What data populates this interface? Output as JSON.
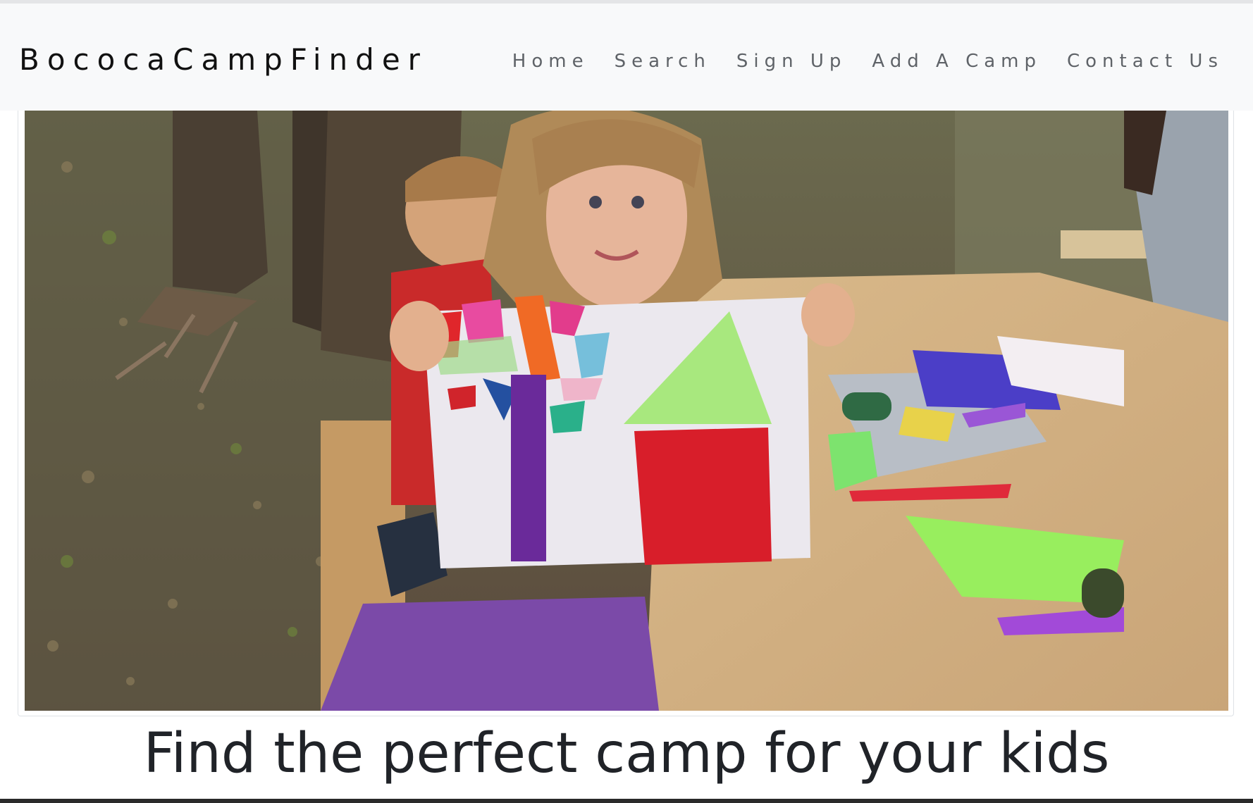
{
  "brand": {
    "name": "BococaCampFinder"
  },
  "nav": {
    "items": [
      {
        "label": "Home"
      },
      {
        "label": "Search"
      },
      {
        "label": "Sign Up"
      },
      {
        "label": "Add A Camp"
      },
      {
        "label": "Contact Us"
      }
    ]
  },
  "hero": {
    "headline": "Find the perfect camp for your kids"
  },
  "colors": {
    "navbar_bg": "#f8f9fa",
    "nav_link": "#5f6368",
    "brand_text": "#111111",
    "headline_text": "#202328"
  }
}
